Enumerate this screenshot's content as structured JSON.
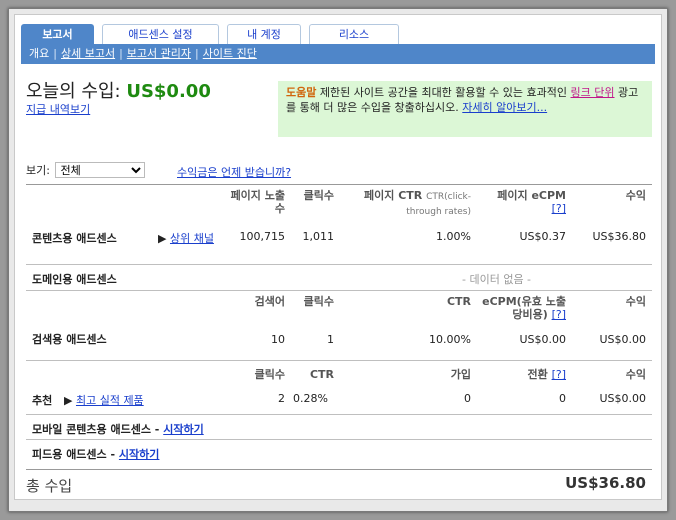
{
  "tabs": [
    {
      "label": "보고서",
      "active": true
    },
    {
      "label": "애드센스 설정",
      "active": false
    },
    {
      "label": "내 계정",
      "active": false
    },
    {
      "label": "리소스",
      "active": false
    }
  ],
  "subnav": {
    "overview": "개요",
    "detailed_reports": "상세 보고서",
    "report_manager": "보고서 관리자",
    "site_diagnostics": "사이트 진단"
  },
  "header": {
    "today_label": "오늘의 수입:",
    "today_amount": "US$0.00",
    "payment_history": "지급 내역보기"
  },
  "help": {
    "title": "도움말",
    "text1": "제한된 사이트 공간을 최대한 활용할 수 있는 효과적인",
    "link1": "링크 단위",
    "text2": "광고를 통해 더 많은 수입을 창출하십시오.",
    "link2": "자세히 알아보기..."
  },
  "view": {
    "label": "보기:",
    "selected": "전체",
    "payment_question": "수익금은 언제 받습니까?"
  },
  "content_section": {
    "headers": {
      "pageviews": "페이지 노출수",
      "clicks": "클릭수",
      "ctr": "페이지 CTR",
      "ctr_note": "CTR(click-through rates)",
      "ecpm": "페이지 eCPM",
      "help": "[?]",
      "earnings": "수익"
    },
    "label": "콘텐츠용 애드센스",
    "channel_link": "상위 채널",
    "pageviews": "100,715",
    "clicks": "1,011",
    "ctr": "1.00%",
    "ecpm": "US$0.37",
    "earnings": "US$36.80"
  },
  "domain_section": {
    "label": "도메인용 애드센스",
    "no_data": "- 데이터 없음 -"
  },
  "search_section": {
    "headers": {
      "searches": "검색어",
      "clicks": "클릭수",
      "ctr": "CTR",
      "ecpm": "eCPM(유효 노출당비용)",
      "help": "[?]",
      "earnings": "수익"
    },
    "label": "검색용 애드센스",
    "searches": "10",
    "clicks": "1",
    "ctr": "10.00%",
    "ecpm": "US$0.00",
    "earnings": "US$0.00"
  },
  "referral_section": {
    "headers": {
      "clicks": "클릭수",
      "ctr": "CTR",
      "signups": "가입",
      "conversions": "전환",
      "help": "[?]",
      "earnings": "수익"
    },
    "label": "추천",
    "top_products_link": "최고 실적 제품",
    "clicks": "2",
    "ctr": "0.28%",
    "signups": "0",
    "conversions": "0",
    "earnings": "US$0.00"
  },
  "mobile_section": {
    "label": "모바일 콘텐츠용 애드센스 -",
    "start_link": "시작하기"
  },
  "feed_section": {
    "label": "피드용 애드센스 -",
    "start_link": "시작하기"
  },
  "total": {
    "label": "총 수입",
    "amount": "US$36.80"
  },
  "colors": {
    "tab_active": "#4f86c9",
    "amount_green": "#1e8a10",
    "help_bg": "#dcf7d6",
    "link": "#1a3fcc"
  }
}
